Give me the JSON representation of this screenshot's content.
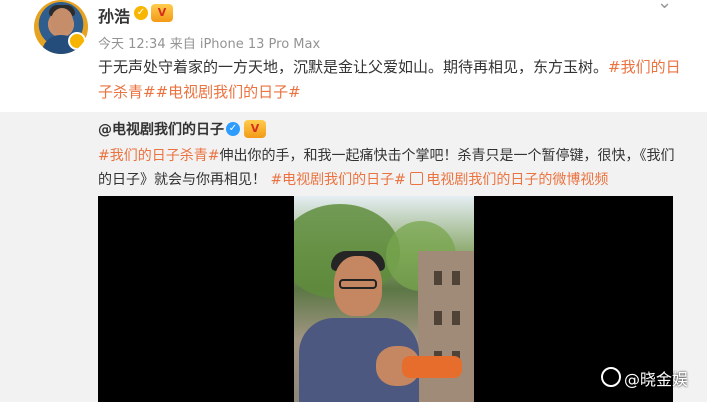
{
  "post": {
    "author": "孙浩",
    "meta": "今天 12:34 来自 iPhone 13 Pro Max",
    "content_text": "于无声处守着家的一方天地，沉默是金让父爱如山。期待再相见，东方玉树。",
    "content_tags": [
      "#我们的日子杀青#",
      "#电视剧我们的日子#"
    ]
  },
  "repost": {
    "author": "@电视剧我们的日子",
    "tag1": "#我们的日子杀青#",
    "text1": "伸出你的手，和我一起痛快击个掌吧！杀青只是一个暂停键，很快，《我们的日子》就会与你再相见！",
    "tag2": "#电视剧我们的日子#",
    "video_link": "电视剧我们的日子的微博视频"
  },
  "watermark": "@晓金娱",
  "colors": {
    "accent": "#eb7340",
    "verify_gold": "#f8b600",
    "verify_blue": "#2d9cff",
    "repost_bg": "#f2f2f2"
  },
  "icons": [
    "more-chevron-icon",
    "verified-icon",
    "vip-badge-icon",
    "video-link-icon",
    "weibo-logo-icon"
  ]
}
